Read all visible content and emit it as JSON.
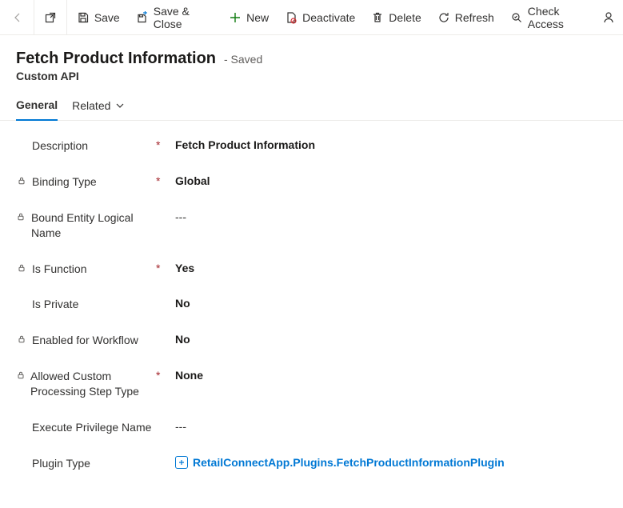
{
  "toolbar": {
    "save": "Save",
    "saveClose": "Save & Close",
    "new": "New",
    "deactivate": "Deactivate",
    "delete": "Delete",
    "refresh": "Refresh",
    "checkAccess": "Check Access"
  },
  "header": {
    "title": "Fetch Product Information",
    "status": "- Saved",
    "subtitle": "Custom API"
  },
  "tabs": {
    "general": "General",
    "related": "Related"
  },
  "fields": {
    "description": {
      "label": "Description",
      "value": "Fetch Product Information"
    },
    "bindingType": {
      "label": "Binding Type",
      "value": "Global"
    },
    "boundEntity": {
      "label": "Bound Entity Logical Name",
      "value": "---"
    },
    "isFunction": {
      "label": "Is Function",
      "value": "Yes"
    },
    "isPrivate": {
      "label": "Is Private",
      "value": "No"
    },
    "enabledWorkflow": {
      "label": "Enabled for Workflow",
      "value": "No"
    },
    "allowedStep": {
      "label": "Allowed Custom Processing Step Type",
      "value": "None"
    },
    "execPriv": {
      "label": "Execute Privilege Name",
      "value": "---"
    },
    "pluginType": {
      "label": "Plugin Type",
      "value": "RetailConnectApp.Plugins.FetchProductInformationPlugin"
    }
  }
}
